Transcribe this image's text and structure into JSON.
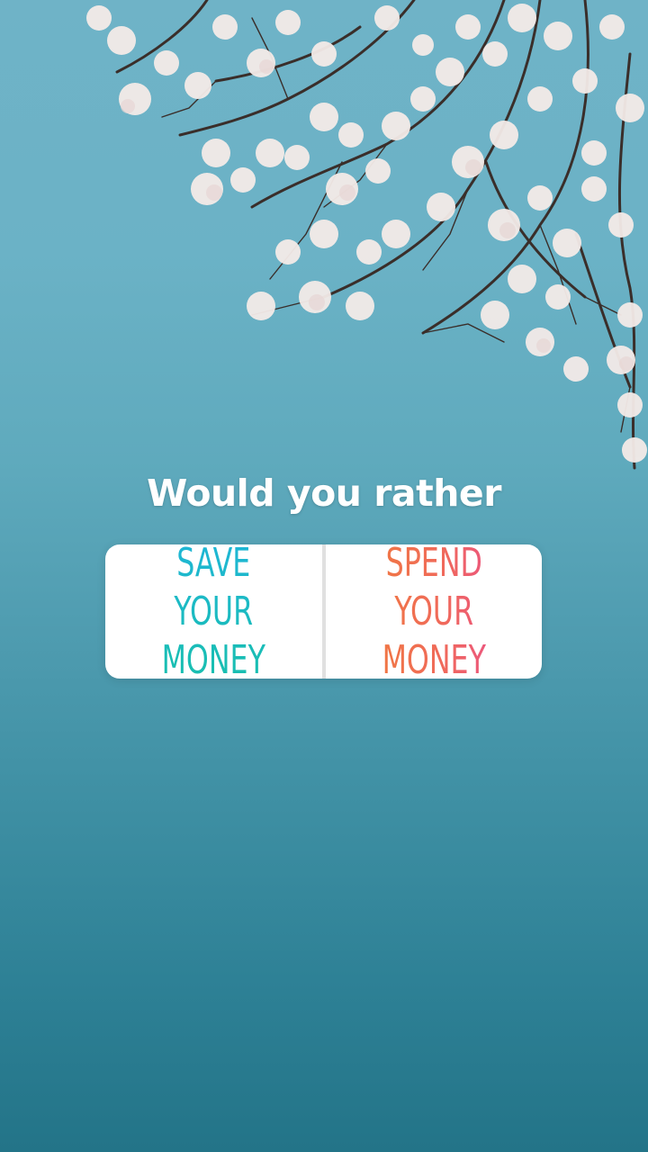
{
  "question": "Would you rather",
  "options": [
    {
      "label": "SAVE YOUR\nMONEY"
    },
    {
      "label": "SPEND YOUR\nMONEY"
    }
  ],
  "colors": {
    "save_gradient": [
      "#1fb6d6",
      "#18bfae"
    ],
    "spend_gradient": [
      "#f07a3e",
      "#ea4f8a"
    ],
    "background_top": "#6fb3c7",
    "background_bottom": "#237488"
  }
}
